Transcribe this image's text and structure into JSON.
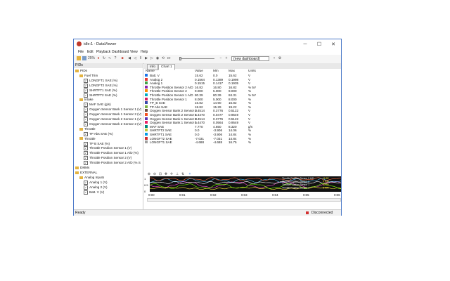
{
  "window": {
    "title": "idle:1 - DataViewer",
    "min": "─",
    "max": "☐",
    "close": "✕"
  },
  "menu": [
    "File",
    "Edit",
    "Playback",
    "Dashboard",
    "View",
    "Help"
  ],
  "toolbar": {
    "dashboard_value": "(new dashboard)",
    "zoom_label": "25%",
    "minus": "−",
    "plus": "+"
  },
  "tree": {
    "header": "PIDs",
    "rows": [
      {
        "indent": 0,
        "type": "folder",
        "label": "PIDs"
      },
      {
        "indent": 1,
        "type": "folder",
        "label": "Fuel Trim"
      },
      {
        "indent": 2,
        "type": "check",
        "label": "LONGFT1 SAE (%)"
      },
      {
        "indent": 2,
        "type": "check",
        "label": "LONGFT2 SAE (%)"
      },
      {
        "indent": 2,
        "type": "check",
        "label": "SHRTFT1 SAE (%)"
      },
      {
        "indent": 2,
        "type": "check",
        "label": "SHRTFT2 SAE (%)"
      },
      {
        "indent": 1,
        "type": "folder",
        "label": "Intake"
      },
      {
        "indent": 2,
        "type": "check",
        "label": "MAF SAE (g/s)"
      },
      {
        "indent": 2,
        "type": "check",
        "label": "Oxygen Sensor Bank 1 Sensor 1 (V)"
      },
      {
        "indent": 2,
        "type": "check",
        "label": "Oxygen Sensor Bank 1 Sensor 2 (V)"
      },
      {
        "indent": 2,
        "type": "check",
        "label": "Oxygen Sensor Bank 2 Sensor 1 (V)"
      },
      {
        "indent": 2,
        "type": "check",
        "label": "Oxygen Sensor Bank 2 Sensor 2 (V)"
      },
      {
        "indent": 1,
        "type": "folder",
        "label": "Throttle"
      },
      {
        "indent": 2,
        "type": "check",
        "label": "TP Abs SAE (%)"
      },
      {
        "indent": 1,
        "type": "folder",
        "label": "Throttle"
      },
      {
        "indent": 2,
        "type": "check",
        "label": "TP B SAE (%)"
      },
      {
        "indent": 2,
        "type": "check",
        "label": "Throttle Position Sensor 1 (V)"
      },
      {
        "indent": 2,
        "type": "check",
        "label": "Throttle Position Sensor 1 A/D (%)"
      },
      {
        "indent": 2,
        "type": "check",
        "label": "Throttle Position Sensor 2 (V)"
      },
      {
        "indent": 2,
        "type": "check",
        "label": "Throttle Position Sensor 2 A/D (% S"
      },
      {
        "indent": 0,
        "type": "folder",
        "label": "DMMs"
      },
      {
        "indent": 0,
        "type": "folder",
        "label": "EXTERNAL"
      },
      {
        "indent": 1,
        "type": "folder",
        "label": "Analog Inputs"
      },
      {
        "indent": 2,
        "type": "check",
        "label": "Analog 1 (V)"
      },
      {
        "indent": 2,
        "type": "check",
        "label": "Analog 2 (V)"
      },
      {
        "indent": 2,
        "type": "check",
        "label": "Batt. V (V)"
      }
    ]
  },
  "tabs": [
    "Info",
    "Chart 1"
  ],
  "table": {
    "headers": [
      "Name",
      "Value",
      "Min",
      "Max",
      "Units"
    ],
    "rows": [
      {
        "name": "Batt. V",
        "value": "15.62",
        "min": "0.0",
        "max": "15.62",
        "units": "V",
        "color": "#1a73e8"
      },
      {
        "name": "Analog 2",
        "value": "0.1564",
        "min": "0.1389",
        "max": "0.1998",
        "units": "V",
        "color": "#e53935"
      },
      {
        "name": "Analog 1",
        "value": "0.1515",
        "min": "0.1417",
        "max": "0.1935",
        "units": "V",
        "color": "#43a047"
      },
      {
        "name": "Throttle Position Sensor 2 A/D",
        "value": "16.82",
        "min": "16.80",
        "max": "16.82",
        "units": "% 5V",
        "color": "#8e24aa"
      },
      {
        "name": "Throttle Position Sensor 2",
        "value": "9.000",
        "min": "5.000",
        "max": "9.000",
        "units": "%",
        "color": "#fb8c00"
      },
      {
        "name": "Throttle Position Sensor 1 A/D",
        "value": "80.39",
        "min": "80.39",
        "max": "84.31",
        "units": "% 5V",
        "color": "#00acc1"
      },
      {
        "name": "Throttle Position Sensor 1",
        "value": "8.000",
        "min": "5.000",
        "max": "8.000",
        "units": "%",
        "color": "#d81b60"
      },
      {
        "name": "TP_B SAE",
        "value": "16.82",
        "min": "14.90",
        "max": "16.82",
        "units": "%",
        "color": "#3949ab"
      },
      {
        "name": "TP Abs SAE",
        "value": "18.82",
        "min": "15.29",
        "max": "19.22",
        "units": "%",
        "color": "#7cb342"
      },
      {
        "name": "Oxygen Sensor Bank 2 Sensor 2",
        "value": "0.4514",
        "min": "0.3776",
        "max": "0.5122",
        "units": "V",
        "color": "#6d4c41"
      },
      {
        "name": "Oxygen Sensor Bank 2 Sensor 1",
        "value": "0.4470",
        "min": "0.0477",
        "max": "0.9549",
        "units": "V",
        "color": "#f4511e"
      },
      {
        "name": "Oxygen Sensor Bank 1 Sensor 2",
        "value": "0.4514",
        "min": "0.3776",
        "max": "0.5122",
        "units": "V",
        "color": "#5e35b1"
      },
      {
        "name": "Oxygen Sensor Bank 1 Sensor 1",
        "value": "0.4470",
        "min": "0.0564",
        "max": "0.9549",
        "units": "V",
        "color": "#e91e63"
      },
      {
        "name": "MAF SAE",
        "value": "7.770",
        "min": "4.650",
        "max": "8.320",
        "units": "g/s",
        "color": "#00897b"
      },
      {
        "name": "SHRTFT2 SAE",
        "value": "0.0",
        "min": "-3.906",
        "max": "14.06",
        "units": "%",
        "color": "#c0ca33"
      },
      {
        "name": "SHRTFT1 SAE",
        "value": "0.0",
        "min": "-3.906",
        "max": "14.84",
        "units": "%",
        "color": "#039be5"
      },
      {
        "name": "LONGFT2 SAE",
        "value": "-7.031",
        "min": "-7.031",
        "max": "14.84",
        "units": "%",
        "color": "#d32f2f"
      },
      {
        "name": "LONGFT1 SAE",
        "value": "-4.688",
        "min": "-4.688",
        "max": "16.75",
        "units": "%",
        "color": "#9e9e9e"
      }
    ]
  },
  "chart": {
    "y_labels": [
      "1",
      "0.5",
      "0"
    ],
    "x_labels": [
      "0:00",
      "0:01",
      "0:02",
      "0:03",
      "0:04",
      "0:05",
      "0:06"
    ],
    "legend_lines": [
      "Throttle Position Sensor 2 A/D",
      "Throttle Position Sensor 2",
      "Throttle Position Sensor 1",
      "Throttle Position Sensor 1"
    ],
    "legend_values": [
      "16.82",
      "9.000",
      "80.39",
      "8.000"
    ]
  },
  "status": {
    "left": "Ready",
    "right": "Disconnected",
    "right_color": "#d32f2f"
  }
}
